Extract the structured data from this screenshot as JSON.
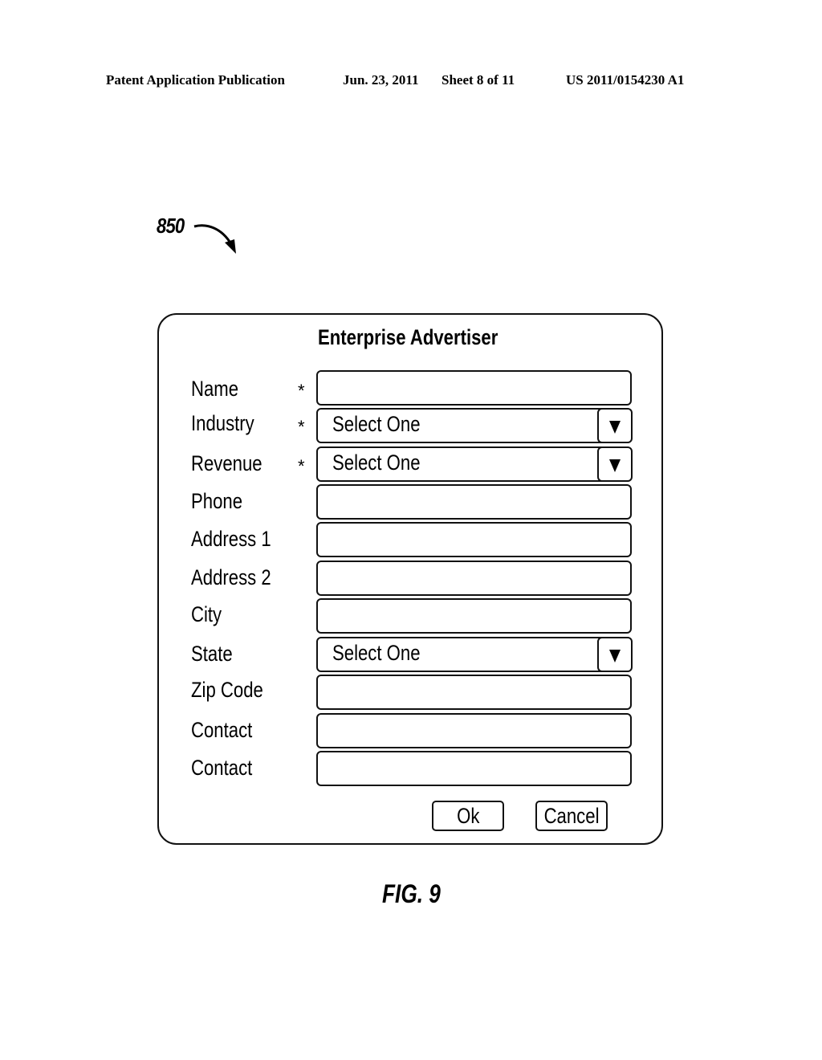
{
  "header": {
    "publication": "Patent Application Publication",
    "date": "Jun. 23, 2011",
    "sheet": "Sheet 8 of 11",
    "patent_number": "US 2011/0154230 A1"
  },
  "reference_numeral": "850",
  "dialog": {
    "title": "Enterprise Advertiser",
    "required_marker": "*",
    "fields": [
      {
        "label": "Name",
        "required": true,
        "type": "text",
        "value": ""
      },
      {
        "label": "Industry",
        "required": true,
        "type": "select",
        "value": "Select One",
        "icon": "dropdown-triangle-icon"
      },
      {
        "label": "Revenue",
        "required": true,
        "type": "select",
        "value": "Select One",
        "icon": "dropdown-triangle-icon"
      },
      {
        "label": "Phone",
        "required": false,
        "type": "text",
        "value": ""
      },
      {
        "label": "Address 1",
        "required": false,
        "type": "text",
        "value": ""
      },
      {
        "label": "Address 2",
        "required": false,
        "type": "text",
        "value": ""
      },
      {
        "label": "City",
        "required": false,
        "type": "text",
        "value": ""
      },
      {
        "label": "State",
        "required": false,
        "type": "select",
        "value": "Select One",
        "icon": "dropdown-triangle-icon"
      },
      {
        "label": "Zip Code",
        "required": false,
        "type": "text",
        "value": ""
      },
      {
        "label": "Contact",
        "required": false,
        "type": "text",
        "value": ""
      },
      {
        "label": "Contact",
        "required": false,
        "type": "text",
        "value": ""
      }
    ],
    "buttons": {
      "ok": "Ok",
      "cancel": "Cancel"
    }
  },
  "figure_caption": "FIG. 9"
}
